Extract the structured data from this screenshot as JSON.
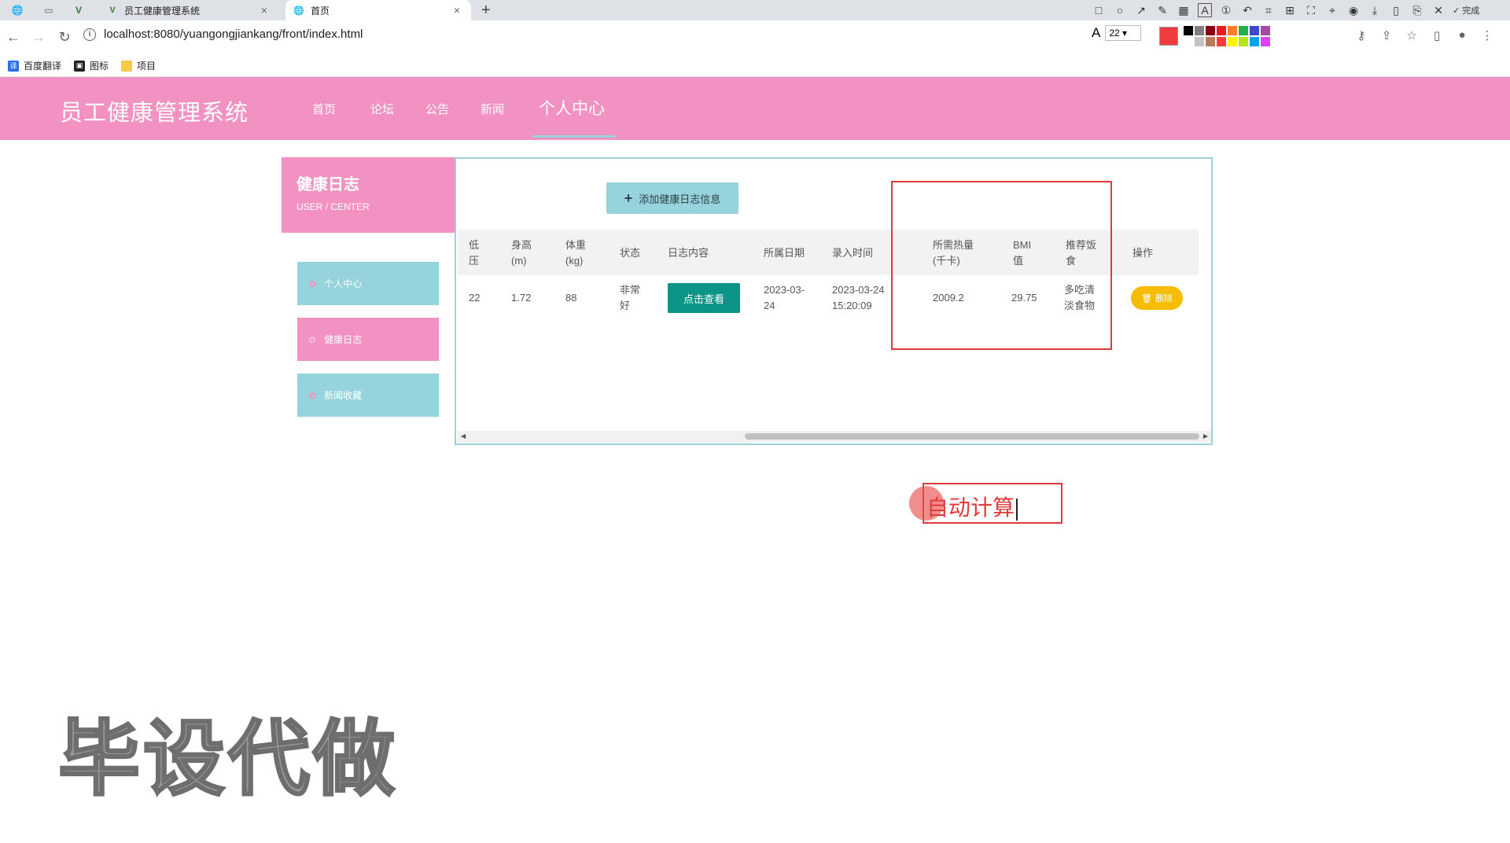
{
  "browser": {
    "tabs": [
      {
        "title": "员工健康管理系统",
        "close": "×"
      },
      {
        "title": "首页",
        "close": "×"
      }
    ],
    "new_tab": "+",
    "url": "localhost:8080/yuangongjiankang/front/index.html",
    "bookmarks": [
      {
        "label": "百度翻译",
        "icon_name": "translate-icon"
      },
      {
        "label": "图标",
        "icon_name": "image-icon"
      },
      {
        "label": "项目",
        "icon_name": "folder-icon"
      }
    ],
    "annotation_tool": {
      "font_glyph": "A",
      "font_size": "22",
      "done_label": "完成",
      "current_color": "#f03c3c",
      "palette": [
        "#000000",
        "#7f7f7f",
        "#880015",
        "#ed1c24",
        "#ff7f27",
        "#22b14c",
        "#3f48cc",
        "#a349a4",
        "#ffffff",
        "#c3c3c3",
        "#b97a57",
        "#ff3b3b",
        "#fff200",
        "#b5e61d",
        "#00a2e8",
        "#e040fb"
      ]
    }
  },
  "site": {
    "title": "员工健康管理系统",
    "menu": [
      "首页",
      "论坛",
      "公告",
      "新闻",
      "个人中心"
    ],
    "active_menu": "个人中心",
    "colors": {
      "primary_pink": "#f192c3",
      "teal": "#96d3dc",
      "view_green": "#0d9488",
      "delete_yellow": "#f5bc00"
    }
  },
  "sidebar": {
    "title": "健康日志",
    "subtitle": "USER / CENTER",
    "items": [
      {
        "label": "个人中心",
        "active": false
      },
      {
        "label": "健康日志",
        "active": true
      },
      {
        "label": "新闻收藏",
        "active": false
      }
    ]
  },
  "main": {
    "add_button": "添加健康日志信息",
    "columns": [
      "低压",
      "身高(m)",
      "体重(kg)",
      "状态",
      "日志内容",
      "所属日期",
      "录入时间",
      "所需热量(千卡)",
      "BMI值",
      "推荐饭食",
      "操作"
    ],
    "column_lines": {
      "low_pressure": [
        "低",
        "压"
      ],
      "height": [
        "身高",
        "(m)"
      ],
      "weight": [
        "体重",
        "(kg)"
      ],
      "status": [
        "状态"
      ],
      "content": [
        "日志内容"
      ],
      "date": [
        "所属日期"
      ],
      "entry_time": [
        "录入时间"
      ],
      "calories": [
        "所需热量",
        "(千卡)"
      ],
      "bmi": [
        "BMI",
        "值"
      ],
      "food": [
        "推荐饭",
        "食"
      ],
      "actions": [
        "操作"
      ]
    },
    "rows": [
      {
        "low_pressure": "22",
        "height": "1.72",
        "weight": "88",
        "status": [
          "非常",
          "好"
        ],
        "view_button": "点击查看",
        "date": [
          "2023-03-",
          "24"
        ],
        "entry_time": [
          "2023-03-24",
          "15:20:09"
        ],
        "calories": "2009.2",
        "bmi": "29.75",
        "food": [
          "多吃清",
          "淡食物"
        ],
        "delete_button": "删除"
      }
    ]
  },
  "annotation": {
    "text": "自动计算"
  },
  "watermark": "毕设代做"
}
